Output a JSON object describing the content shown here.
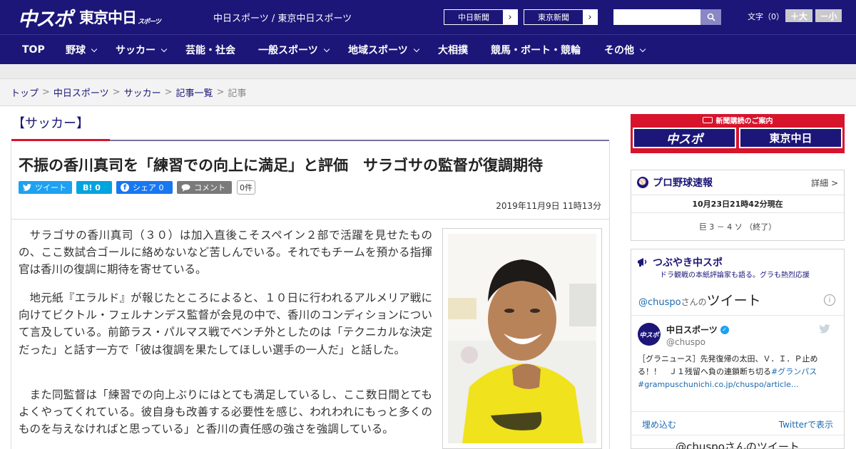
{
  "header": {
    "logo_chuspo": "中スポ",
    "logo_tokyo": "東京中日",
    "logo_tokyo_sub": "スポーツ",
    "site_name": "中日スポーツ / 東京中日スポーツ",
    "btn_chunichi": "中日新聞",
    "btn_tokyo": "東京新聞",
    "font_size_label": "文字（0）",
    "font_bigger": "＋大",
    "font_smaller": "－小"
  },
  "nav": [
    "TOP",
    "野球",
    "サッカー",
    "芸能・社会",
    "一般スポーツ",
    "地域スポーツ",
    "大相撲",
    "競馬・ボート・競輪",
    "その他"
  ],
  "breadcrumb": {
    "items": [
      "トップ",
      "中日スポーツ",
      "サッカー",
      "記事一覧"
    ],
    "current": "記事"
  },
  "article": {
    "category": "【サッカー】",
    "title": "不振の香川真司を「練習での向上に満足」と評価　サラゴサの監督が復調期待",
    "share": {
      "tweet": "ツイート",
      "hatena": "B! 0",
      "facebook": "シェア 0",
      "comment": "コメント",
      "count": "0件"
    },
    "date": "2019年11月9日 11時13分",
    "paragraphs": [
      "サラゴサの香川真司（３０）は加入直後こそスペイン２部で活躍を見せたものの、ここ数試合ゴールに絡めないなど苦しんでいる。それでもチームを預かる指揮官は香川の復調に期待を寄せている。",
      "地元紙『エラルド』が報じたところによると、１０日に行われるアルメリア戦に向けてビクトル・フェルナンデス監督が会見の中で、香川のコンディションについて言及している。前節ラス・パルマス戦でベンチ外としたのは「テクニカルな決定だった」と話す一方で「彼は復調を果たしてほしい選手の一人だ」と話した。",
      "また同監督は「練習での向上ぶりにはとても満足しているし、ここ数日間とてもよくやってくれている。彼自身も改善する必要性を感じ、われわれにもっと多くのものを与えなければと思っている」と香川の責任感の強さを強調している。"
    ]
  },
  "sidebar": {
    "subscribe": {
      "heading": "新聞購読のご案内",
      "chuspo": "中スポ",
      "tokyo": "東京中日"
    },
    "baseball": {
      "title": "プロ野球速報",
      "detail": "詳細 >",
      "time": "10月23日21時42分現在",
      "score": "巨 3 － 4 ソ （終了）"
    },
    "tweets": {
      "title": "つぶやき中スポ",
      "subtitle": "ドラ観戦の本紙評論家も語る。グラも熱烈応援",
      "handle": "@chuspo",
      "handle_suffix": "さんの",
      "tweets_label": "ツイート",
      "user_name": "中日スポーツ",
      "user_handle": "@chuspo",
      "tweet_text": "［グラニュース］先発復帰の太田、Ｖ．Ｉ．Ｐ止める！！　Ｊ１残留へ負の連鎖断ち切る",
      "hashtag": "#グランパス",
      "link": "#grampuschunichi.co.jp/chuspo/article…",
      "embed": "埋め込む",
      "view_on_twitter": "Twitterで表示",
      "footer": "@chuspoさんのツイート"
    }
  },
  "colors": {
    "brand": "#1c1678",
    "accent": "#d7142c",
    "twitter": "#1da1f2",
    "facebook": "#1877f2",
    "hatena": "#00a4de"
  }
}
